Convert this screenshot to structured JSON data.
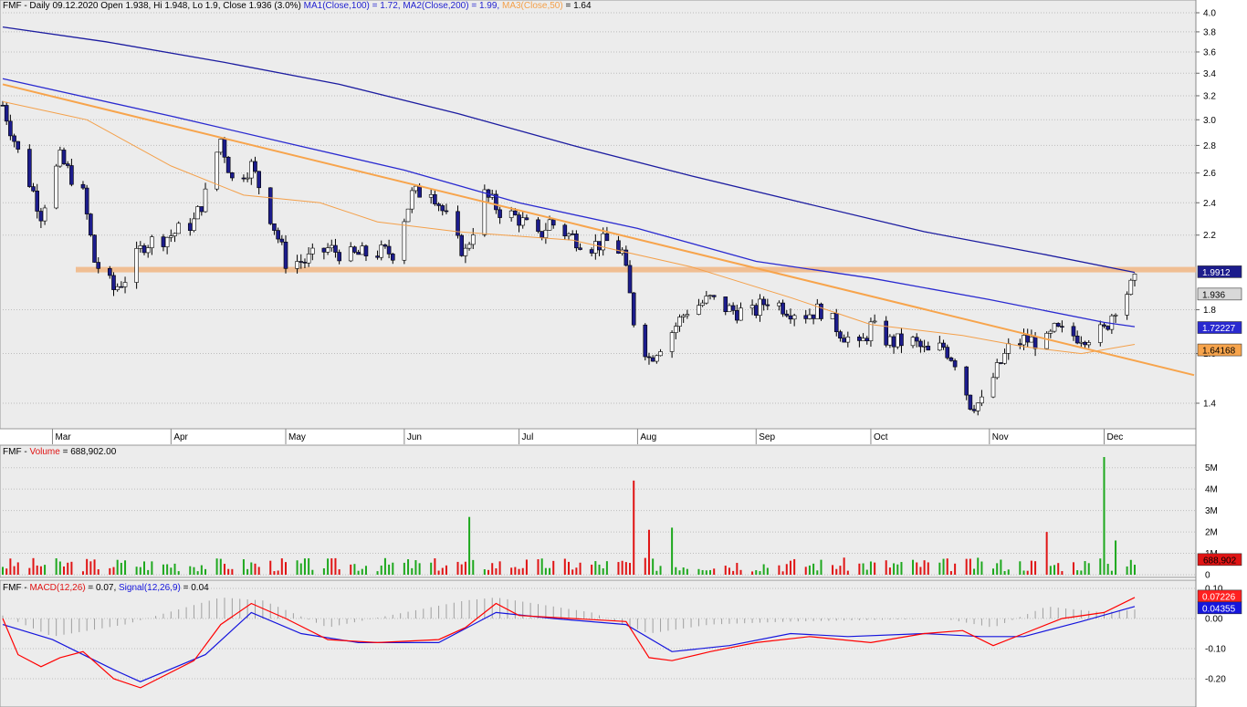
{
  "colors": {
    "panel_bg": "#ececec",
    "axis_bg": "#ffffff",
    "grid": "#bdbdbd",
    "up": "#ffffff",
    "down": "#1c1c8c",
    "ma1": "#2a2ad0",
    "ma2": "#1c1ca0",
    "ma3": "#f4a04a",
    "trend": "#f7a44c",
    "band": "#f1b98a",
    "vol_up": "#1ea81e",
    "vol_down": "#e01414",
    "macd": "#ff0000",
    "signal": "#1515dd",
    "hist": "#a0a0a0"
  },
  "header": {
    "price": {
      "symbol": "FMF",
      "text": "- Daily 09.12.2020 Open 1.938, Hi 1.948, Lo 1.9, Close 1.936 (3.0%)",
      "ma1": "MA1(Close,100) = 1.72,",
      "ma2": "MA2(Close,200) = 1.99,",
      "ma3": "MA3(Close,50)",
      "ma3_val": "= 1.64"
    },
    "volume": {
      "symbol": "FMF",
      "sep": "-",
      "label": "Volume",
      "val": "= 688,902.00"
    },
    "macd": {
      "symbol": "FMF",
      "sep": "-",
      "label": "MACD(12,26)",
      "val": "= 0.07,",
      "signal": "Signal(12,26,9)",
      "signal_val": "= 0.04"
    }
  },
  "months": [
    "Mar",
    "Apr",
    "May",
    "Jun",
    "Jul",
    "Aug",
    "Sep",
    "Oct",
    "Nov",
    "Dec"
  ],
  "price_axis": [
    "4.0",
    "3.8",
    "3.6",
    "3.4",
    "3.2",
    "3.0",
    "2.8",
    "2.6",
    "2.4",
    "2.2",
    "1.8",
    "1.6",
    "1.4"
  ],
  "price_tags": {
    "ma2": "1.9912",
    "close": "1.936",
    "ma1": "1.72227",
    "ma3": "1.64168"
  },
  "volume_axis": [
    "5M",
    "4M",
    "3M",
    "2M",
    "1M",
    "0"
  ],
  "volume_tag": "688,902",
  "macd_axis": [
    "0.10",
    "0.00",
    "-0.10",
    "-0.20"
  ],
  "macd_tags": {
    "macd": "0.07226",
    "signal": "0.04355"
  },
  "chart_data": [
    {
      "type": "candlestick",
      "title": "FMF - Daily",
      "x_range": [
        "2020-02-17",
        "2020-12-09"
      ],
      "ylim": [
        1.33,
        4.05
      ],
      "y_scale": "log",
      "ohlc_last": {
        "date": "2020-12-09",
        "open": 1.938,
        "high": 1.948,
        "low": 1.9,
        "close": 1.936,
        "change_pct": 3.0
      },
      "close_path": [
        [
          "2020-02-17",
          3.12
        ],
        [
          "2020-02-21",
          2.75
        ],
        [
          "2020-02-27",
          2.33
        ],
        [
          "2020-03-03",
          2.7
        ],
        [
          "2020-03-09",
          2.45
        ],
        [
          "2020-03-12",
          2.05
        ],
        [
          "2020-03-17",
          1.9
        ],
        [
          "2020-03-20",
          1.96
        ],
        [
          "2020-03-25",
          2.15
        ],
        [
          "2020-04-01",
          2.2
        ],
        [
          "2020-04-07",
          2.28
        ],
        [
          "2020-04-10",
          2.45
        ],
        [
          "2020-04-14",
          2.85
        ],
        [
          "2020-04-17",
          2.55
        ],
        [
          "2020-04-22",
          2.65
        ],
        [
          "2020-04-28",
          2.25
        ],
        [
          "2020-05-01",
          2.05
        ],
        [
          "2020-05-06",
          2.05
        ],
        [
          "2020-05-12",
          2.12
        ],
        [
          "2020-05-18",
          2.08
        ],
        [
          "2020-05-25",
          2.1
        ],
        [
          "2020-05-29",
          2.1
        ],
        [
          "2020-06-03",
          2.45
        ],
        [
          "2020-06-08",
          2.5
        ],
        [
          "2020-06-12",
          2.3
        ],
        [
          "2020-06-15",
          2.15
        ],
        [
          "2020-06-17",
          2.1
        ],
        [
          "2020-06-22",
          2.45
        ],
        [
          "2020-06-26",
          2.35
        ],
        [
          "2020-07-01",
          2.3
        ],
        [
          "2020-07-06",
          2.18
        ],
        [
          "2020-07-09",
          2.28
        ],
        [
          "2020-07-14",
          2.2
        ],
        [
          "2020-07-20",
          2.14
        ],
        [
          "2020-07-24",
          2.16
        ],
        [
          "2020-07-28",
          2.1
        ],
        [
          "2020-07-31",
          1.75
        ],
        [
          "2020-08-04",
          1.58
        ],
        [
          "2020-08-10",
          1.7
        ],
        [
          "2020-08-14",
          1.8
        ],
        [
          "2020-08-20",
          1.85
        ],
        [
          "2020-08-25",
          1.8
        ],
        [
          "2020-08-31",
          1.78
        ],
        [
          "2020-09-04",
          1.85
        ],
        [
          "2020-09-10",
          1.8
        ],
        [
          "2020-09-14",
          1.78
        ],
        [
          "2020-09-18",
          1.8
        ],
        [
          "2020-09-23",
          1.7
        ],
        [
          "2020-09-28",
          1.62
        ],
        [
          "2020-10-01",
          1.72
        ],
        [
          "2020-10-06",
          1.65
        ],
        [
          "2020-10-12",
          1.65
        ],
        [
          "2020-10-16",
          1.6
        ],
        [
          "2020-10-20",
          1.63
        ],
        [
          "2020-10-23",
          1.57
        ],
        [
          "2020-10-27",
          1.4
        ],
        [
          "2020-10-30",
          1.4
        ],
        [
          "2020-11-02",
          1.5
        ],
        [
          "2020-11-06",
          1.62
        ],
        [
          "2020-11-10",
          1.66
        ],
        [
          "2020-11-16",
          1.65
        ],
        [
          "2020-11-18",
          1.7
        ],
        [
          "2020-11-23",
          1.68
        ],
        [
          "2020-11-27",
          1.68
        ],
        [
          "2020-12-01",
          1.7
        ],
        [
          "2020-12-04",
          1.82
        ],
        [
          "2020-12-09",
          1.936
        ]
      ],
      "ma_series": [
        {
          "name": "MA1(Close,100)",
          "last": 1.72,
          "path": [
            [
              "2020-02-17",
              3.35
            ],
            [
              "2020-04-01",
              3.03
            ],
            [
              "2020-05-01",
              2.82
            ],
            [
              "2020-06-01",
              2.62
            ],
            [
              "2020-07-01",
              2.4
            ],
            [
              "2020-08-01",
              2.24
            ],
            [
              "2020-09-01",
              2.05
            ],
            [
              "2020-10-01",
              1.96
            ],
            [
              "2020-11-01",
              1.85
            ],
            [
              "2020-12-01",
              1.74
            ],
            [
              "2020-12-09",
              1.72
            ]
          ]
        },
        {
          "name": "MA2(Close,200)",
          "last": 1.99,
          "path": [
            [
              "2020-02-17",
              3.85
            ],
            [
              "2020-03-15",
              3.7
            ],
            [
              "2020-04-15",
              3.5
            ],
            [
              "2020-05-15",
              3.3
            ],
            [
              "2020-06-15",
              3.05
            ],
            [
              "2020-07-15",
              2.8
            ],
            [
              "2020-08-15",
              2.58
            ],
            [
              "2020-09-15",
              2.39
            ],
            [
              "2020-10-15",
              2.22
            ],
            [
              "2020-11-15",
              2.09
            ],
            [
              "2020-12-09",
              1.99
            ]
          ]
        },
        {
          "name": "MA3(Close,50)",
          "last": 1.64,
          "path": [
            [
              "2020-02-17",
              3.15
            ],
            [
              "2020-03-10",
              3.0
            ],
            [
              "2020-04-01",
              2.65
            ],
            [
              "2020-04-20",
              2.45
            ],
            [
              "2020-05-10",
              2.4
            ],
            [
              "2020-05-25",
              2.28
            ],
            [
              "2020-06-15",
              2.22
            ],
            [
              "2020-07-15",
              2.17
            ],
            [
              "2020-08-15",
              2.02
            ],
            [
              "2020-09-10",
              1.86
            ],
            [
              "2020-10-01",
              1.73
            ],
            [
              "2020-10-25",
              1.68
            ],
            [
              "2020-11-10",
              1.63
            ],
            [
              "2020-11-25",
              1.6
            ],
            [
              "2020-12-09",
              1.64
            ]
          ]
        }
      ],
      "trendline": [
        [
          "2020-02-17",
          3.3
        ],
        [
          "2020-12-31",
          1.51
        ]
      ],
      "horizontal_band": {
        "low": 1.99,
        "high": 2.005
      }
    },
    {
      "type": "bar",
      "title": "FMF - Volume",
      "last": 688902,
      "ylim": [
        0,
        5800000
      ],
      "peaks": [
        [
          "2020-03-01",
          700000
        ],
        [
          "2020-06-18",
          2700000
        ],
        [
          "2020-07-31",
          4400000
        ],
        [
          "2020-08-04",
          2100000
        ],
        [
          "2020-08-10",
          2200000
        ],
        [
          "2020-11-16",
          2000000
        ],
        [
          "2020-12-01",
          5500000
        ],
        [
          "2020-12-04",
          1600000
        ]
      ]
    },
    {
      "type": "line",
      "title": "FMF - MACD(12,26) / Signal(12,26,9)",
      "ylim": [
        -0.24,
        0.11
      ],
      "series": [
        {
          "name": "MACD(12,26)",
          "last": 0.07,
          "values": [
            [
              "2020-02-17",
              0.0
            ],
            [
              "2020-02-21",
              -0.12
            ],
            [
              "2020-02-27",
              -0.16
            ],
            [
              "2020-03-03",
              -0.13
            ],
            [
              "2020-03-09",
              -0.11
            ],
            [
              "2020-03-17",
              -0.2
            ],
            [
              "2020-03-24",
              -0.23
            ],
            [
              "2020-04-07",
              -0.14
            ],
            [
              "2020-04-14",
              -0.02
            ],
            [
              "2020-04-22",
              0.05
            ],
            [
              "2020-05-01",
              0.0
            ],
            [
              "2020-05-12",
              -0.07
            ],
            [
              "2020-05-25",
              -0.08
            ],
            [
              "2020-06-10",
              -0.07
            ],
            [
              "2020-06-17",
              -0.03
            ],
            [
              "2020-06-25",
              0.05
            ],
            [
              "2020-07-01",
              0.01
            ],
            [
              "2020-07-15",
              0.0
            ],
            [
              "2020-07-29",
              -0.01
            ],
            [
              "2020-08-04",
              -0.13
            ],
            [
              "2020-08-10",
              -0.14
            ],
            [
              "2020-08-20",
              -0.11
            ],
            [
              "2020-09-01",
              -0.08
            ],
            [
              "2020-09-15",
              -0.06
            ],
            [
              "2020-10-01",
              -0.08
            ],
            [
              "2020-10-15",
              -0.05
            ],
            [
              "2020-10-25",
              -0.04
            ],
            [
              "2020-11-02",
              -0.09
            ],
            [
              "2020-11-10",
              -0.05
            ],
            [
              "2020-11-20",
              0.0
            ],
            [
              "2020-12-01",
              0.02
            ],
            [
              "2020-12-09",
              0.07
            ]
          ]
        },
        {
          "name": "Signal(12,26,9)",
          "last": 0.04,
          "values": [
            [
              "2020-02-17",
              -0.02
            ],
            [
              "2020-03-01",
              -0.07
            ],
            [
              "2020-03-17",
              -0.17
            ],
            [
              "2020-03-24",
              -0.21
            ],
            [
              "2020-04-10",
              -0.12
            ],
            [
              "2020-04-22",
              0.02
            ],
            [
              "2020-05-05",
              -0.05
            ],
            [
              "2020-05-20",
              -0.08
            ],
            [
              "2020-06-10",
              -0.08
            ],
            [
              "2020-06-25",
              0.02
            ],
            [
              "2020-07-10",
              0.0
            ],
            [
              "2020-07-29",
              -0.02
            ],
            [
              "2020-08-10",
              -0.11
            ],
            [
              "2020-08-25",
              -0.09
            ],
            [
              "2020-09-10",
              -0.05
            ],
            [
              "2020-09-25",
              -0.06
            ],
            [
              "2020-10-15",
              -0.05
            ],
            [
              "2020-10-30",
              -0.06
            ],
            [
              "2020-11-10",
              -0.06
            ],
            [
              "2020-11-25",
              -0.01
            ],
            [
              "2020-12-09",
              0.04
            ]
          ]
        }
      ],
      "histogram": [
        [
          "2020-02-17",
          0.01
        ],
        [
          "2020-03-01",
          -0.06
        ],
        [
          "2020-03-20",
          -0.02
        ],
        [
          "2020-04-14",
          0.07
        ],
        [
          "2020-04-25",
          0.06
        ],
        [
          "2020-05-12",
          -0.03
        ],
        [
          "2020-06-17",
          0.06
        ],
        [
          "2020-06-25",
          0.07
        ],
        [
          "2020-07-20",
          0.02
        ],
        [
          "2020-08-04",
          -0.05
        ],
        [
          "2020-08-20",
          -0.02
        ],
        [
          "2020-09-10",
          -0.01
        ],
        [
          "2020-10-20",
          0.0
        ],
        [
          "2020-11-02",
          -0.03
        ],
        [
          "2020-11-16",
          0.04
        ],
        [
          "2020-12-01",
          0.02
        ],
        [
          "2020-12-09",
          0.03
        ]
      ]
    }
  ]
}
